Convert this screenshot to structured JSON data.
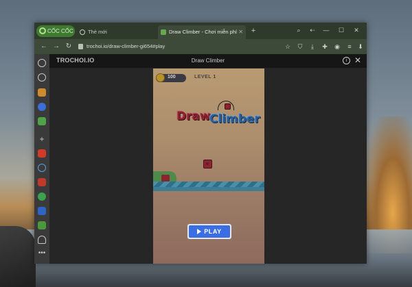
{
  "browser": {
    "brand_label": "CỐC CỐC",
    "tabs": [
      {
        "label": "Thẻ mới"
      },
      {
        "label": "Draw Climber - Chơi miễn phí"
      }
    ],
    "new_tab_symbol": "+",
    "window_controls": {
      "minimize": "—",
      "maximize": "☐",
      "close": "✕"
    },
    "address": "trochoi.io/draw-climber-gi654#play",
    "toolbar_icons": [
      "back-icon",
      "forward-icon",
      "reload-icon"
    ],
    "extension_icons": [
      "star-icon",
      "shield-icon",
      "download-icon",
      "puzzle-icon",
      "profile-icon",
      "menu-icon"
    ]
  },
  "sidebar": {
    "icons": [
      "settings-icon",
      "history-icon",
      "crown-icon",
      "messenger-icon",
      "gamepad-icon",
      "add-icon",
      "youtube-icon",
      "audio-icon",
      "news-icon",
      "translate-icon",
      "ad-icon",
      "calendar-icon",
      "bell-icon",
      "more-icon"
    ]
  },
  "game_header": {
    "site_logo": "TROCHOI.IO",
    "title": "Draw Climber"
  },
  "game": {
    "coins": "100",
    "level": "LEVEL 1",
    "logo_part1": "Draw",
    "logo_part2": "Climber",
    "play_label": "PLAY"
  },
  "colors": {
    "play_button": "#3b6ee3",
    "brand_green": "#3f7a31",
    "cube": "#8b2431"
  }
}
